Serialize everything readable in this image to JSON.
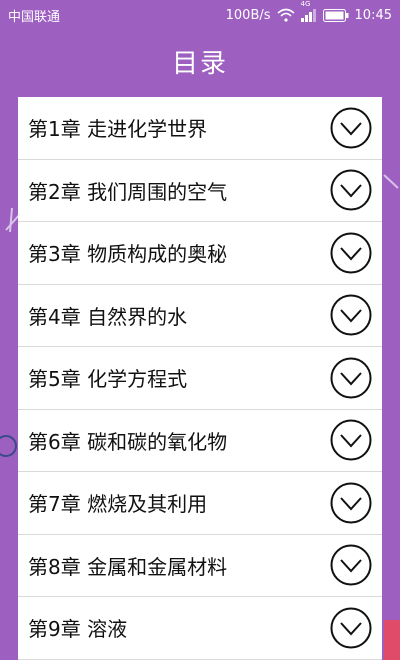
{
  "status_bar": {
    "carrier": "中国联通",
    "net_speed": "100B/s",
    "network_type": "4G",
    "time": "10:45"
  },
  "header": {
    "title": "目录"
  },
  "chapters": [
    {
      "label": "第1章 走进化学世界"
    },
    {
      "label": "第2章 我们周围的空气"
    },
    {
      "label": "第3章 物质构成的奥秘"
    },
    {
      "label": "第4章 自然界的水"
    },
    {
      "label": "第5章 化学方程式"
    },
    {
      "label": "第6章 碳和碳的氧化物"
    },
    {
      "label": "第7章 燃烧及其利用"
    },
    {
      "label": "第8章 金属和金属材料"
    },
    {
      "label": "第9章 溶液"
    }
  ],
  "icons": {
    "expand": "chevron-down-circle-icon"
  },
  "colors": {
    "background": "#9d5fc0",
    "list": "#ffffff",
    "text": "#111111"
  }
}
